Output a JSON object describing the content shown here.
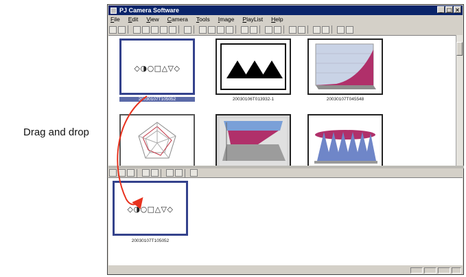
{
  "caption": "Drag and drop",
  "window": {
    "title": "PJ Camera Software",
    "controls": [
      "_",
      "□",
      "×"
    ]
  },
  "menu": [
    "File",
    "Edit",
    "View",
    "Camera",
    "Tools",
    "Image",
    "PlayList",
    "Help"
  ],
  "thumbnails": [
    {
      "label": "20030107T105052",
      "kind": "shapes",
      "shapes_text": "◇◑○□△▽◇",
      "selected": true
    },
    {
      "label": "20030106T013932-1",
      "kind": "triangles",
      "selected": false
    },
    {
      "label": "20030107T045548",
      "kind": "surface-chart",
      "selected": false
    },
    {
      "label": "",
      "kind": "radar-chart",
      "selected": false
    },
    {
      "label": "",
      "kind": "3d-bar-chart",
      "selected": false
    },
    {
      "label": "",
      "kind": "cone-chart",
      "selected": false
    }
  ],
  "playlist": [
    {
      "label": "20030107T105052",
      "shapes_text": "◇◑○□△▽◇"
    }
  ],
  "colors": {
    "title_bar": "#0a246a",
    "selection_border": "#34428c",
    "drag_arrow": "#e8321e",
    "chart_magenta": "#b0306a"
  }
}
